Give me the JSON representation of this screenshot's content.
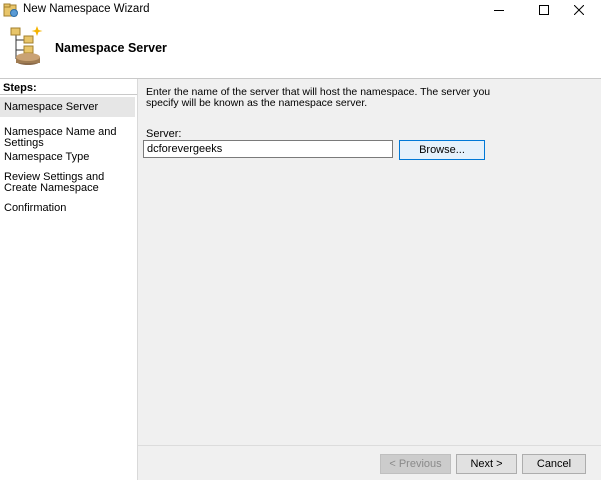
{
  "window": {
    "title": "New Namespace Wizard",
    "minimize_icon": "minimize-icon",
    "maximize_icon": "maximize-icon",
    "close_icon": "close-icon"
  },
  "header": {
    "title": "Namespace Server",
    "icon": "namespace-wizard-icon"
  },
  "sidebar": {
    "heading": "Steps:",
    "items": [
      {
        "label": "Namespace Server",
        "active": true
      },
      {
        "label": "Namespace Name and Settings",
        "active": false
      },
      {
        "label": "Namespace Type",
        "active": false
      },
      {
        "label": "Review Settings and Create Namespace",
        "active": false
      },
      {
        "label": "Confirmation",
        "active": false
      }
    ]
  },
  "main": {
    "description": "Enter the name of the server that will host the namespace. The server you specify will be known as the namespace server.",
    "server_label": "Server:",
    "server_value": "dcforevergeeks",
    "browse_label": "Browse..."
  },
  "footer": {
    "previous_label": "< Previous",
    "next_label": "Next >",
    "cancel_label": "Cancel"
  },
  "colors": {
    "focus_border": "#0078d7",
    "active_step_bg": "#e6e6e6",
    "panel_bg": "#f0f0f0"
  }
}
